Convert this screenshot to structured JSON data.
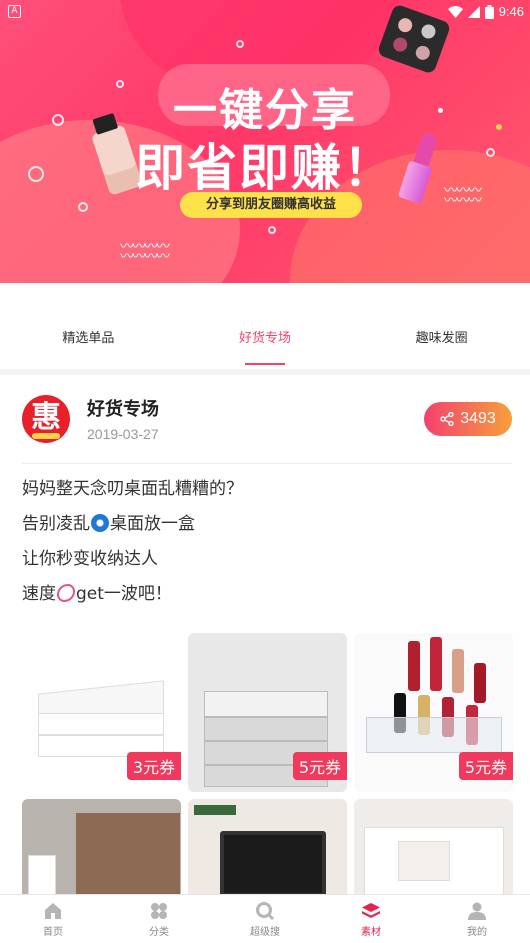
{
  "status_bar": {
    "app_badge": "A",
    "time": "9:46"
  },
  "banner": {
    "headline_line1": "一键分享",
    "headline_line2": "即省即赚！",
    "subline": "分享到朋友圈赚高收益"
  },
  "tabs": [
    {
      "label": "精选单品",
      "active": false
    },
    {
      "label": "好货专场",
      "active": true
    },
    {
      "label": "趣味发圈",
      "active": false
    }
  ],
  "post": {
    "avatar_char": "惠",
    "author": "好货专场",
    "date": "2019-03-27",
    "share_count": "3493",
    "lines": {
      "line1": "妈妈整天念叨桌面乱糟糟的？",
      "line2_a": "告别凌乱",
      "line2_b": "桌面放一盒",
      "line3": "让你秒变收纳达人",
      "line4_a": "速度",
      "line4_b": "get一波吧！"
    },
    "coupons": [
      "3元券",
      "5元券",
      "5元券"
    ]
  },
  "bottom_nav": [
    {
      "label": "首页",
      "icon": "home-icon",
      "active": false
    },
    {
      "label": "分类",
      "icon": "category-icon",
      "active": false
    },
    {
      "label": "超级搜",
      "icon": "search-icon",
      "active": false
    },
    {
      "label": "素材",
      "icon": "layers-icon",
      "active": true
    },
    {
      "label": "我的",
      "icon": "profile-icon",
      "active": false
    }
  ],
  "colors": {
    "accent": "#f0466a",
    "coupon": "#f0395c",
    "share_from": "#f4406f",
    "share_to": "#f6a03a"
  }
}
